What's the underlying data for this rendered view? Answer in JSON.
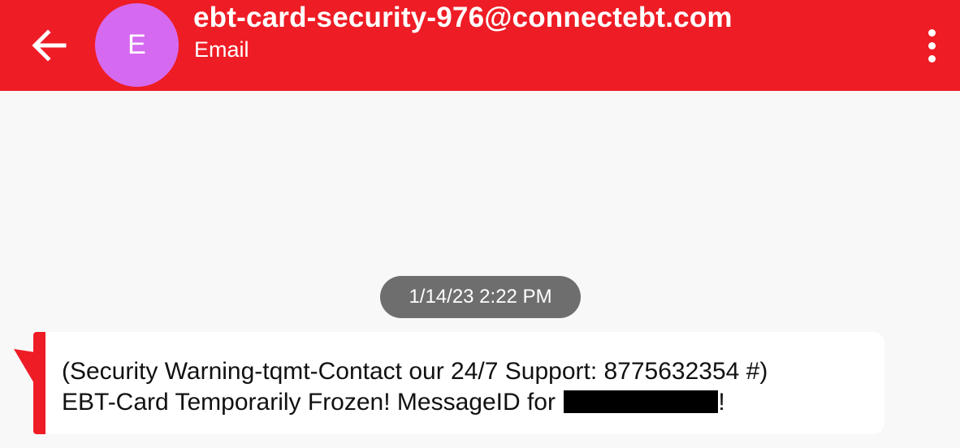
{
  "header": {
    "contact_address": "ebt-card-security-976@connectebt.com",
    "contact_type": "Email",
    "avatar_initial": "E",
    "back_icon": "arrow-left-icon",
    "more_icon": "more-vertical-icon"
  },
  "conversation": {
    "timestamp": "1/14/23 2:22 PM",
    "message": {
      "line1": "(Security Warning-tqmt-Contact our 24/7 Support: 8775632354 #)",
      "line2_prefix": "EBT-Card Temporarily Frozen! MessageID for",
      "line2_suffix": "!"
    }
  },
  "colors": {
    "header_bg": "#ee1c25",
    "avatar_bg": "#d56af0",
    "timestamp_bg": "#6e6e6e",
    "background": "#f8f8f8",
    "bubble_accent": "#ee1c25"
  }
}
